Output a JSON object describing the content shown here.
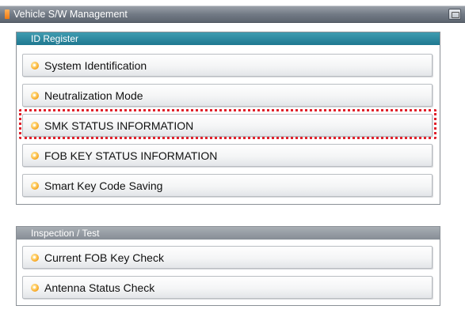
{
  "window": {
    "title": "Vehicle S/W Management"
  },
  "id_register": {
    "header": "ID Register",
    "items": [
      {
        "label": "System Identification"
      },
      {
        "label": "Neutralization Mode"
      },
      {
        "label": "SMK STATUS INFORMATION"
      },
      {
        "label": "FOB KEY STATUS INFORMATION"
      },
      {
        "label": "Smart Key Code Saving"
      }
    ]
  },
  "inspection": {
    "header": "Inspection / Test",
    "items": [
      {
        "label": "Current FOB Key Check"
      },
      {
        "label": "Antenna Status Check"
      }
    ]
  },
  "highlighted_item": "SMK STATUS INFORMATION",
  "colors": {
    "title_bar": "#727a85",
    "id_register_header": "#2a88a0",
    "inspection_header": "#969ca3",
    "bullet": "#f6a21b",
    "highlight_border": "#e0202a"
  },
  "icons": {
    "title_flag": "orange-flag-icon",
    "title_right": "window-icon",
    "bullet": "orange-bullet-icon"
  }
}
